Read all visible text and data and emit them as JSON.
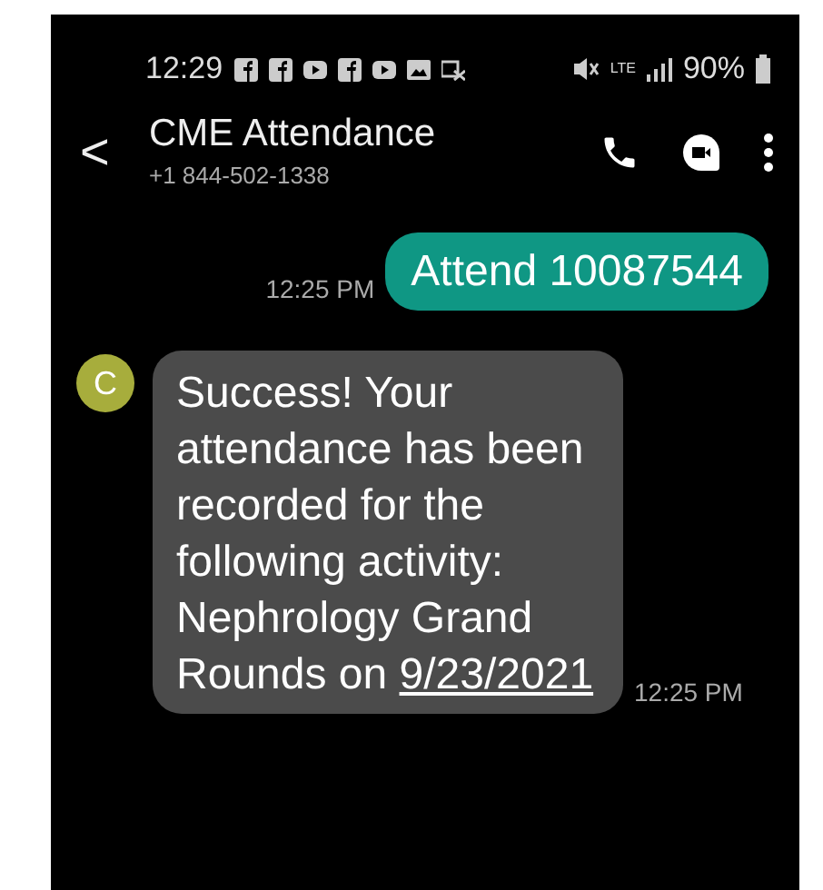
{
  "status_bar": {
    "time": "12:29",
    "network": "LTE",
    "battery": "90%"
  },
  "header": {
    "back": "<",
    "title": "CME Attendance",
    "subtitle": "+1 844-502-1338"
  },
  "messages": [
    {
      "kind": "sent",
      "text": "Attend 10087544",
      "time": "12:25 PM"
    },
    {
      "kind": "received",
      "avatar": "C",
      "text": "Success!  Your attendance has been recorded for the following activity: Nephrology Grand Rounds on",
      "link": "9/23/2021",
      "time": "12:25 PM"
    }
  ]
}
